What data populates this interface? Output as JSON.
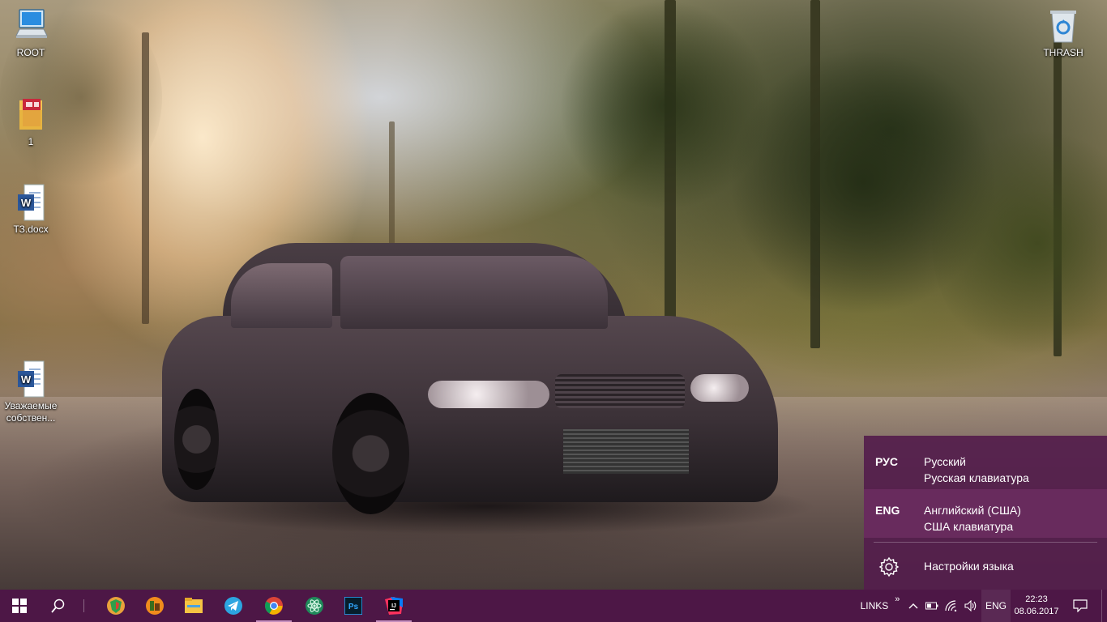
{
  "desktop": {
    "icons": [
      {
        "label": "ROOT",
        "icon": "computer-icon"
      },
      {
        "label": "1",
        "icon": "folder-icon"
      },
      {
        "label": "ТЗ.docx",
        "icon": "word-document-icon"
      },
      {
        "label": "Уважаемые собствен...",
        "icon": "word-document-icon"
      },
      {
        "label": "THRASH",
        "icon": "recycle-bin-icon"
      }
    ]
  },
  "language_flyout": {
    "languages": [
      {
        "code": "РУС",
        "name": "Русский",
        "keyboard": "Русская клавиатура",
        "selected": false
      },
      {
        "code": "ENG",
        "name": "Английский (США)",
        "keyboard": "США клавиатура",
        "selected": true
      }
    ],
    "settings_label": "Настройки языка",
    "settings_icon": "gear-icon",
    "background": "#541e4c"
  },
  "taskbar": {
    "background": "#4d1746",
    "start_icon": "windows-logo-icon",
    "search_icon": "search-icon",
    "apps": [
      {
        "name": "shield-app-icon",
        "running": false
      },
      {
        "name": "fl-studio-icon",
        "running": false
      },
      {
        "name": "file-explorer-icon",
        "running": false
      },
      {
        "name": "telegram-icon",
        "running": false
      },
      {
        "name": "chrome-icon",
        "running": true
      },
      {
        "name": "atom-icon",
        "running": false
      },
      {
        "name": "photoshop-icon",
        "running": false
      },
      {
        "name": "intellij-icon",
        "running": true
      }
    ],
    "tray": {
      "toolbar_label": "LINKS",
      "toolbar_chevron": "»",
      "input_indicator": "ENG",
      "time": "22:23",
      "date": "08.06.2017"
    }
  }
}
